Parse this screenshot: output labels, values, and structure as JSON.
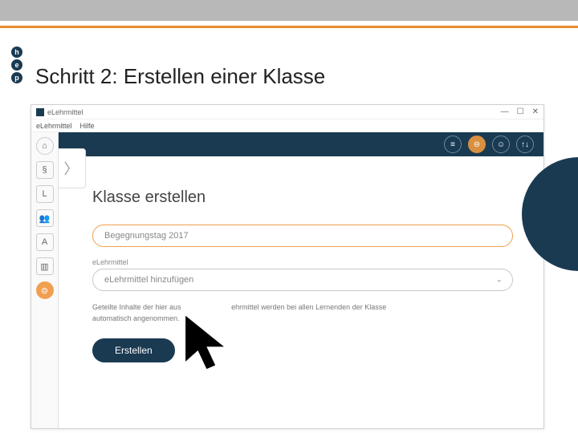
{
  "slide": {
    "title": "Schritt 2: Erstellen einer Klasse",
    "logo": [
      "h",
      "e",
      "p"
    ]
  },
  "window": {
    "app_title": "eLehrmittel",
    "menu": [
      "eLehrmittel",
      "Hilfe"
    ],
    "controls": {
      "min": "—",
      "max": "☐",
      "close": "✕"
    }
  },
  "sidebar": {
    "items": [
      {
        "name": "home-icon",
        "glyph": "⌂",
        "round": true
      },
      {
        "name": "paragraph-icon",
        "glyph": "§"
      },
      {
        "name": "letter-l-icon",
        "glyph": "L"
      },
      {
        "name": "people-icon",
        "glyph": "👥"
      },
      {
        "name": "label-a-icon",
        "glyph": "A"
      },
      {
        "name": "media-icon",
        "glyph": "▥"
      },
      {
        "name": "group-icon",
        "glyph": "⊜",
        "orange": true,
        "round": true
      }
    ]
  },
  "header": {
    "buttons": [
      {
        "name": "menu-icon",
        "glyph": "≡"
      },
      {
        "name": "class-icon",
        "glyph": "⊜",
        "active": true
      },
      {
        "name": "users-icon",
        "glyph": "☺"
      },
      {
        "name": "sync-icon",
        "glyph": "↑↓"
      }
    ],
    "chevron": "〉"
  },
  "form": {
    "title": "Klasse erstellen",
    "name_input": {
      "value": "Begegnungstag 2017"
    },
    "section_label": "eLehrmittel",
    "select": {
      "placeholder": "eLehrmittel hinzufügen"
    },
    "note_line1": "Geteilte Inhalte der hier aus",
    "note_line2": "ehrmittel werden bei allen Lernenden der Klasse",
    "note_line3": "automatisch angenommen.",
    "submit_label": "Erstellen"
  }
}
